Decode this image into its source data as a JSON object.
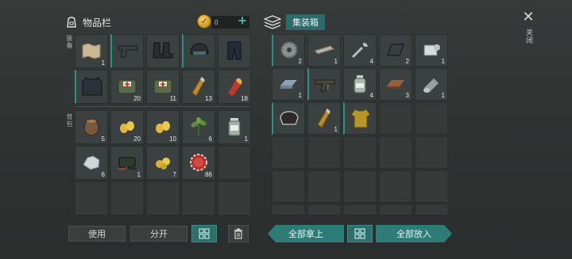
{
  "header": {
    "inventory_title": "物品栏",
    "gold_count": "0",
    "box_title": "集装箱",
    "close_label": "关闭"
  },
  "inventory": {
    "equip_label": "装备",
    "bag_label": "背包",
    "equipment": [
      {
        "name": "map",
        "count": "1"
      },
      {
        "name": "pistol",
        "count": ""
      },
      {
        "name": "boots",
        "count": ""
      },
      {
        "name": "helmet",
        "count": ""
      },
      {
        "name": "pants-armor",
        "count": ""
      },
      {
        "name": "body-armor",
        "count": ""
      },
      {
        "name": "first-aid-bag",
        "count": "20"
      },
      {
        "name": "first-aid-bag",
        "count": "11"
      },
      {
        "name": "rifle-cartridge",
        "count": "13"
      },
      {
        "name": "pill-capsule",
        "count": "18"
      }
    ],
    "bag": [
      {
        "name": "grain-sack",
        "count": "5"
      },
      {
        "name": "corn-kernels",
        "count": "20"
      },
      {
        "name": "corn-kernels",
        "count": "10"
      },
      {
        "name": "herb-leaves",
        "count": "6"
      },
      {
        "name": "medicine-bottle",
        "count": "1"
      },
      {
        "name": "silver-ore",
        "count": "6"
      },
      {
        "name": "battery-charger",
        "count": "1"
      },
      {
        "name": "gold-nuggets",
        "count": "7"
      },
      {
        "name": "bottle-cap",
        "count": "86"
      },
      {
        "name": "",
        "count": ""
      },
      {
        "name": "",
        "count": ""
      },
      {
        "name": "",
        "count": ""
      },
      {
        "name": "",
        "count": ""
      },
      {
        "name": "",
        "count": ""
      },
      {
        "name": "",
        "count": ""
      }
    ]
  },
  "container": {
    "items": [
      {
        "name": "saw-blade",
        "count": "2"
      },
      {
        "name": "metal-bar",
        "count": "1"
      },
      {
        "name": "wrench",
        "count": "4"
      },
      {
        "name": "metal-sheet",
        "count": "2"
      },
      {
        "name": "engine-part",
        "count": "1"
      },
      {
        "name": "steel-ingot",
        "count": "1"
      },
      {
        "name": "smg-weapon",
        "count": ""
      },
      {
        "name": "chemical-bottle",
        "count": "4"
      },
      {
        "name": "wood-plank",
        "count": "3"
      },
      {
        "name": "cloth-roll",
        "count": "1"
      },
      {
        "name": "brass-knuckles",
        "count": ""
      },
      {
        "name": "rifle-cartridge",
        "count": "1"
      },
      {
        "name": "yellow-jacket",
        "count": ""
      },
      {
        "name": "",
        "count": ""
      },
      {
        "name": "",
        "count": ""
      },
      {
        "name": "",
        "count": ""
      },
      {
        "name": "",
        "count": ""
      },
      {
        "name": "",
        "count": ""
      },
      {
        "name": "",
        "count": ""
      },
      {
        "name": "",
        "count": ""
      },
      {
        "name": "",
        "count": ""
      },
      {
        "name": "",
        "count": ""
      },
      {
        "name": "",
        "count": ""
      },
      {
        "name": "",
        "count": ""
      },
      {
        "name": "",
        "count": ""
      },
      {
        "name": "",
        "count": ""
      },
      {
        "name": "",
        "count": ""
      },
      {
        "name": "",
        "count": ""
      },
      {
        "name": "",
        "count": ""
      },
      {
        "name": "",
        "count": ""
      }
    ]
  },
  "actions": {
    "use_label": "使用",
    "split_label": "分开",
    "take_all_label": "全部拿上",
    "put_all_label": "全部放入"
  },
  "colors": {
    "accent": "#2e7c77",
    "gold": "#e0b034"
  }
}
